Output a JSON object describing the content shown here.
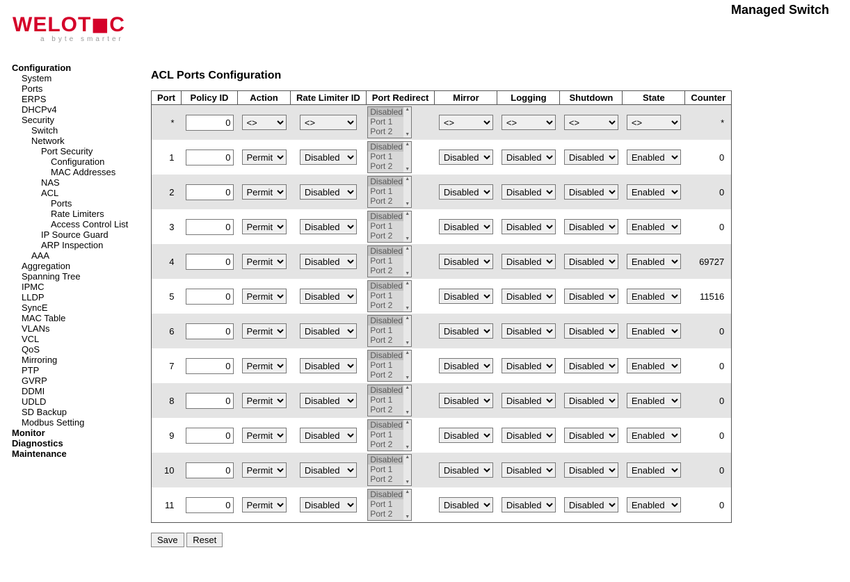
{
  "header": {
    "title": "Managed Switch"
  },
  "logo": {
    "text": "WELOTEC",
    "tag": "a byte smarter"
  },
  "sidebar": {
    "items": [
      {
        "label": "Configuration",
        "level": 0
      },
      {
        "label": "System",
        "level": 1
      },
      {
        "label": "Ports",
        "level": 1
      },
      {
        "label": "ERPS",
        "level": 1
      },
      {
        "label": "DHCPv4",
        "level": 1
      },
      {
        "label": "Security",
        "level": 1
      },
      {
        "label": "Switch",
        "level": 2
      },
      {
        "label": "Network",
        "level": 2
      },
      {
        "label": "Port Security",
        "level": 3
      },
      {
        "label": "Configuration",
        "level": 4
      },
      {
        "label": "MAC Addresses",
        "level": 4
      },
      {
        "label": "NAS",
        "level": 3
      },
      {
        "label": "ACL",
        "level": 3
      },
      {
        "label": "Ports",
        "level": 4
      },
      {
        "label": "Rate Limiters",
        "level": 4
      },
      {
        "label": "Access Control List",
        "level": 4
      },
      {
        "label": "IP Source Guard",
        "level": 3
      },
      {
        "label": "ARP Inspection",
        "level": 3
      },
      {
        "label": "AAA",
        "level": 2
      },
      {
        "label": "Aggregation",
        "level": 1
      },
      {
        "label": "Spanning Tree",
        "level": 1
      },
      {
        "label": "IPMC",
        "level": 1
      },
      {
        "label": "LLDP",
        "level": 1
      },
      {
        "label": "SyncE",
        "level": 1
      },
      {
        "label": "MAC Table",
        "level": 1
      },
      {
        "label": "VLANs",
        "level": 1
      },
      {
        "label": "VCL",
        "level": 1
      },
      {
        "label": "QoS",
        "level": 1
      },
      {
        "label": "Mirroring",
        "level": 1
      },
      {
        "label": "PTP",
        "level": 1
      },
      {
        "label": "GVRP",
        "level": 1
      },
      {
        "label": "DDMI",
        "level": 1
      },
      {
        "label": "UDLD",
        "level": 1
      },
      {
        "label": "SD Backup",
        "level": 1
      },
      {
        "label": "Modbus Setting",
        "level": 1
      },
      {
        "label": "Monitor",
        "level": 0
      },
      {
        "label": "Diagnostics",
        "level": 0
      },
      {
        "label": "Maintenance",
        "level": 0
      }
    ]
  },
  "main": {
    "title": "ACL Ports Configuration",
    "columns": [
      "Port",
      "Policy ID",
      "Action",
      "Rate Limiter ID",
      "Port Redirect",
      "Mirror",
      "Logging",
      "Shutdown",
      "State",
      "Counter"
    ],
    "port_redirect_options": [
      "Disabled",
      "Port 1",
      "Port 2"
    ],
    "rows": [
      {
        "port": "*",
        "policy": "0",
        "action": "<>",
        "rate": "<>",
        "mirror": "<>",
        "logging": "<>",
        "shutdown": "<>",
        "state": "<>",
        "counter": "*"
      },
      {
        "port": "1",
        "policy": "0",
        "action": "Permit",
        "rate": "Disabled",
        "mirror": "Disabled",
        "logging": "Disabled",
        "shutdown": "Disabled",
        "state": "Enabled",
        "counter": "0"
      },
      {
        "port": "2",
        "policy": "0",
        "action": "Permit",
        "rate": "Disabled",
        "mirror": "Disabled",
        "logging": "Disabled",
        "shutdown": "Disabled",
        "state": "Enabled",
        "counter": "0"
      },
      {
        "port": "3",
        "policy": "0",
        "action": "Permit",
        "rate": "Disabled",
        "mirror": "Disabled",
        "logging": "Disabled",
        "shutdown": "Disabled",
        "state": "Enabled",
        "counter": "0"
      },
      {
        "port": "4",
        "policy": "0",
        "action": "Permit",
        "rate": "Disabled",
        "mirror": "Disabled",
        "logging": "Disabled",
        "shutdown": "Disabled",
        "state": "Enabled",
        "counter": "69727"
      },
      {
        "port": "5",
        "policy": "0",
        "action": "Permit",
        "rate": "Disabled",
        "mirror": "Disabled",
        "logging": "Disabled",
        "shutdown": "Disabled",
        "state": "Enabled",
        "counter": "11516"
      },
      {
        "port": "6",
        "policy": "0",
        "action": "Permit",
        "rate": "Disabled",
        "mirror": "Disabled",
        "logging": "Disabled",
        "shutdown": "Disabled",
        "state": "Enabled",
        "counter": "0"
      },
      {
        "port": "7",
        "policy": "0",
        "action": "Permit",
        "rate": "Disabled",
        "mirror": "Disabled",
        "logging": "Disabled",
        "shutdown": "Disabled",
        "state": "Enabled",
        "counter": "0"
      },
      {
        "port": "8",
        "policy": "0",
        "action": "Permit",
        "rate": "Disabled",
        "mirror": "Disabled",
        "logging": "Disabled",
        "shutdown": "Disabled",
        "state": "Enabled",
        "counter": "0"
      },
      {
        "port": "9",
        "policy": "0",
        "action": "Permit",
        "rate": "Disabled",
        "mirror": "Disabled",
        "logging": "Disabled",
        "shutdown": "Disabled",
        "state": "Enabled",
        "counter": "0"
      },
      {
        "port": "10",
        "policy": "0",
        "action": "Permit",
        "rate": "Disabled",
        "mirror": "Disabled",
        "logging": "Disabled",
        "shutdown": "Disabled",
        "state": "Enabled",
        "counter": "0"
      },
      {
        "port": "11",
        "policy": "0",
        "action": "Permit",
        "rate": "Disabled",
        "mirror": "Disabled",
        "logging": "Disabled",
        "shutdown": "Disabled",
        "state": "Enabled",
        "counter": "0"
      }
    ],
    "buttons": {
      "save": "Save",
      "reset": "Reset"
    }
  }
}
